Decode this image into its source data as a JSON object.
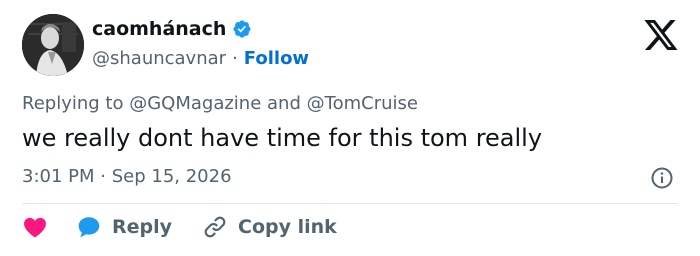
{
  "user": {
    "display_name": "caomhánach",
    "handle": "@shauncavnar",
    "separator": "·",
    "follow_label": "Follow",
    "verified_color": "#1d9bf0",
    "avatar_icon": "profile-photo"
  },
  "brand": {
    "logo_icon": "x-logo-icon"
  },
  "tweet": {
    "replying_prefix": "Replying to",
    "mention_1": "@GQMagazine",
    "conjunction": "and",
    "mention_2": "@TomCruise",
    "text": "we really dont have time for this tom really",
    "time": "3:01 PM",
    "date_separator": "·",
    "date": "Sep 15, 2026"
  },
  "actions": {
    "like_icon": "heart-icon",
    "like_color": "#f91880",
    "reply_label": "Reply",
    "reply_icon": "speech-bubble-icon",
    "reply_color": "#1d9bf0",
    "copy_link_label": "Copy link",
    "copy_link_icon": "link-icon"
  },
  "colors": {
    "text_primary": "#0f1419",
    "text_secondary": "#536471",
    "follow": "#006fd6",
    "divider": "#e1e8ed"
  }
}
